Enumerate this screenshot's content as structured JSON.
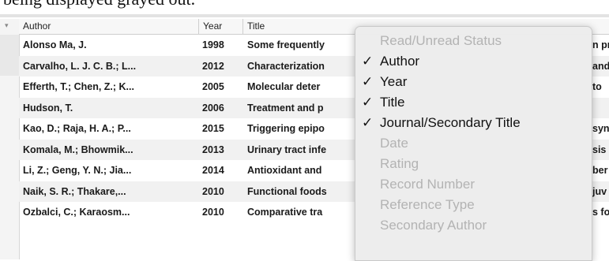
{
  "caption": {
    "text": "being displayed grayed out."
  },
  "table": {
    "columns": {
      "author": "Author",
      "year": "Year",
      "title": "Title"
    },
    "rows": [
      {
        "author": "Alonso Ma, J.",
        "year": "1998",
        "title": "Some frequently",
        "tail": "n pr"
      },
      {
        "author": "Carvalho, L. J. C. B.; L...",
        "year": "2012",
        "title": "Characterization",
        "tail": "and"
      },
      {
        "author": "Efferth, T.; Chen, Z.; K...",
        "year": "2005",
        "title": "Molecular deter",
        "tail": "to"
      },
      {
        "author": "Hudson, T.",
        "year": "2006",
        "title": "Treatment and p",
        "tail": ""
      },
      {
        "author": "Kao, D.; Raja, H. A.; P...",
        "year": "2015",
        "title": "Triggering epipo",
        "tail": "synt"
      },
      {
        "author": "Komala, M.; Bhowmik...",
        "year": "2013",
        "title": "Urinary tract infe",
        "tail": "sis"
      },
      {
        "author": "Li, Z.; Geng, Y. N.; Jia...",
        "year": "2014",
        "title": "Antioxidant and",
        "tail": "ber"
      },
      {
        "author": "Naik, S. R.; Thakare,...",
        "year": "2010",
        "title": "Functional foods",
        "tail": "juv"
      },
      {
        "author": "Ozbalci, C.; Karaosm...",
        "year": "2010",
        "title": "Comparative tra",
        "tail": "s fo"
      }
    ]
  },
  "menu": {
    "check_glyph": "✓",
    "items": [
      {
        "label": "Read/Unread Status",
        "checked": false,
        "enabled": false
      },
      {
        "label": "Author",
        "checked": true,
        "enabled": true
      },
      {
        "label": "Year",
        "checked": true,
        "enabled": true
      },
      {
        "label": "Title",
        "checked": true,
        "enabled": true
      },
      {
        "label": "Journal/Secondary Title",
        "checked": true,
        "enabled": true
      },
      {
        "label": "Date",
        "checked": false,
        "enabled": false
      },
      {
        "label": "Rating",
        "checked": false,
        "enabled": false
      },
      {
        "label": "Record Number",
        "checked": false,
        "enabled": false
      },
      {
        "label": "Reference Type",
        "checked": false,
        "enabled": false
      },
      {
        "label": "Secondary Author",
        "checked": false,
        "enabled": false
      }
    ]
  }
}
